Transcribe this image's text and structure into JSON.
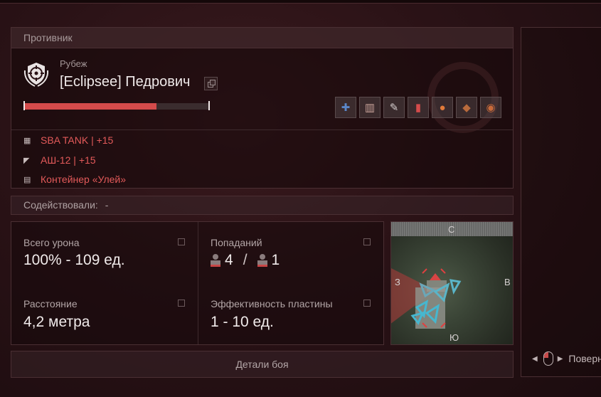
{
  "enemy_panel": {
    "header": "Противник",
    "rank": "Рубеж",
    "player_name": "[Eclipsee] Педрович",
    "health_fraction": 0.72,
    "items": [
      {
        "icon": "medkit-icon",
        "glyph": "✚"
      },
      {
        "icon": "pills-icon",
        "glyph": "▥"
      },
      {
        "icon": "syringe-icon",
        "glyph": "✎"
      },
      {
        "icon": "injector-icon",
        "glyph": "▮"
      },
      {
        "icon": "grenade-icon",
        "glyph": "●"
      },
      {
        "icon": "food-icon",
        "glyph": "◆"
      },
      {
        "icon": "stew-icon",
        "glyph": "◉"
      }
    ],
    "gear": [
      {
        "icon": "armor-icon",
        "text": "SBA TANK | +15"
      },
      {
        "icon": "weapon-icon",
        "text": "АШ-12 | +15"
      },
      {
        "icon": "container-icon",
        "text": "Контейнер «Улей»"
      }
    ]
  },
  "assist": {
    "label": "Содействовали:",
    "value": "-"
  },
  "stats": {
    "total_damage_label": "Всего урона",
    "total_damage_value": "100% - 109 ед.",
    "hits_label": "Попаданий",
    "hits_a": "4",
    "hits_b": "1",
    "distance_label": "Расстояние",
    "distance_value": "4,2 метра",
    "plate_label": "Эффективность пластины",
    "plate_value": "1 - 10 ед."
  },
  "minimap": {
    "north": "С",
    "south": "Ю",
    "west": "З",
    "east": "В"
  },
  "details_button": "Детали боя",
  "rotate_hint": "Поверну",
  "colors": {
    "accent_red": "#d44b4b",
    "gear_text": "#e35a5a"
  }
}
